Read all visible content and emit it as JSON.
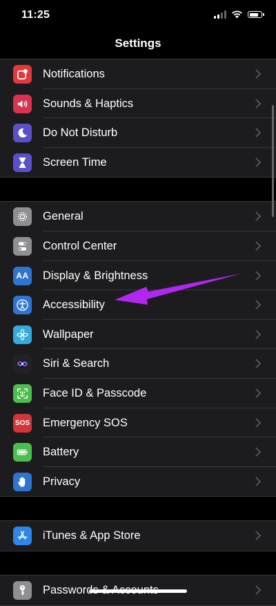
{
  "status": {
    "time": "11:25"
  },
  "nav": {
    "title": "Settings"
  },
  "groups": [
    {
      "items": [
        {
          "label": "Notifications",
          "icon": "notifications-icon",
          "color": "#e0393e"
        },
        {
          "label": "Sounds & Haptics",
          "icon": "speaker-icon",
          "color": "#d8334f"
        },
        {
          "label": "Do Not Disturb",
          "icon": "moon-icon",
          "color": "#5a50c9"
        },
        {
          "label": "Screen Time",
          "icon": "hourglass-icon",
          "color": "#5a50c9"
        }
      ]
    },
    {
      "items": [
        {
          "label": "General",
          "icon": "gear-icon",
          "color": "#8e8e93"
        },
        {
          "label": "Control Center",
          "icon": "toggles-icon",
          "color": "#8e8e93"
        },
        {
          "label": "Display & Brightness",
          "icon": "text-size-icon",
          "color": "#2f74d0"
        },
        {
          "label": "Accessibility",
          "icon": "accessibility-icon",
          "color": "#2f74d0"
        },
        {
          "label": "Wallpaper",
          "icon": "flower-icon",
          "color": "#35aadc"
        },
        {
          "label": "Siri & Search",
          "icon": "siri-icon",
          "color": "#222222"
        },
        {
          "label": "Face ID & Passcode",
          "icon": "face-id-icon",
          "color": "#4cbe4d"
        },
        {
          "label": "Emergency SOS",
          "icon": "sos-icon",
          "color": "#d0363a"
        },
        {
          "label": "Battery",
          "icon": "battery-icon",
          "color": "#4cbe4d"
        },
        {
          "label": "Privacy",
          "icon": "hand-icon",
          "color": "#2f74d0"
        }
      ]
    },
    {
      "items": [
        {
          "label": "iTunes & App Store",
          "icon": "app-store-icon",
          "color": "#2f86e6"
        }
      ]
    },
    {
      "items": [
        {
          "label": "Passwords & Accounts",
          "icon": "key-icon",
          "color": "#8e8e93"
        }
      ]
    }
  ],
  "colors": {
    "background": "#000000",
    "cell": "#1c1c1e",
    "separator": "#38383a",
    "chevron": "#5a5a5f",
    "annotation_arrow": "#b127f0"
  },
  "sos_text": "SOS",
  "aa_text": "AA"
}
